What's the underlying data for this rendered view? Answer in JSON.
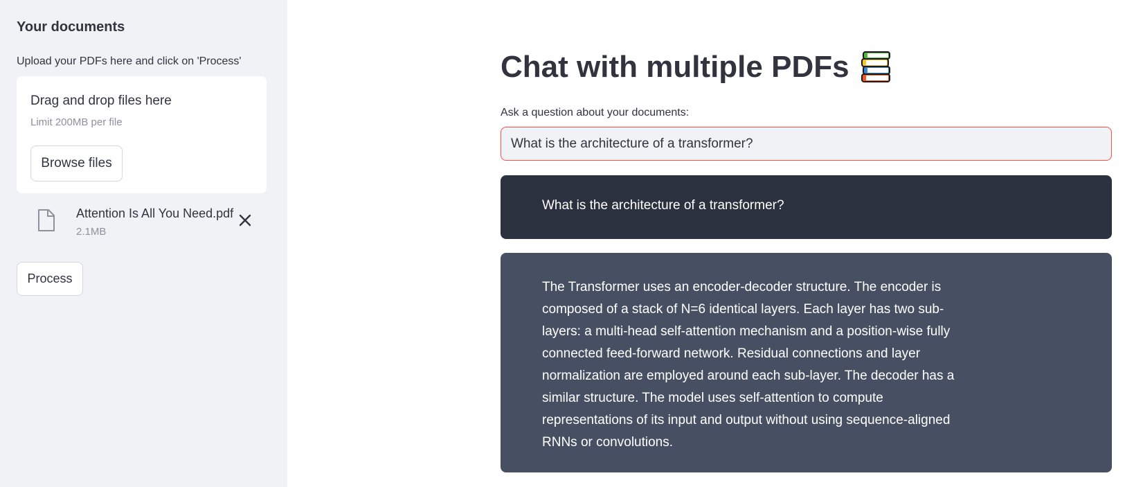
{
  "sidebar": {
    "title": "Your documents",
    "upload_label": "Upload your PDFs here and click on 'Process'",
    "dropzone": {
      "title": "Drag and drop files here",
      "limit": "Limit 200MB per file",
      "browse_label": "Browse files"
    },
    "files": [
      {
        "name": "Attention Is All You Need.pdf",
        "size": "2.1MB"
      }
    ],
    "process_label": "Process"
  },
  "main": {
    "title": "Chat with multiple PDFs",
    "question_label": "Ask a question about your documents:",
    "question_value": "What is the architecture of a transformer?",
    "messages": [
      {
        "role": "user",
        "text": "What is the architecture of a transformer?"
      },
      {
        "role": "bot",
        "text": "The Transformer uses an encoder-decoder structure. The encoder is composed of a stack of N=6 identical layers. Each layer has two sub-layers: a multi-head self-attention mechanism and a position-wise fully connected feed-forward network. Residual connections and layer normalization are employed around each sub-layer. The decoder has a similar structure. The model uses self-attention to compute representations of its input and output without using sequence-aligned RNNs or convolutions."
      }
    ]
  },
  "colors": {
    "sidebar_bg": "#f0f2f6",
    "user_msg_bg": "#2b313e",
    "bot_msg_bg": "#475063",
    "input_focus_border": "#ff4b4b"
  },
  "icons": {
    "title_icon": "books-icon",
    "file_icon": "document-icon",
    "remove_icon": "close-icon"
  }
}
